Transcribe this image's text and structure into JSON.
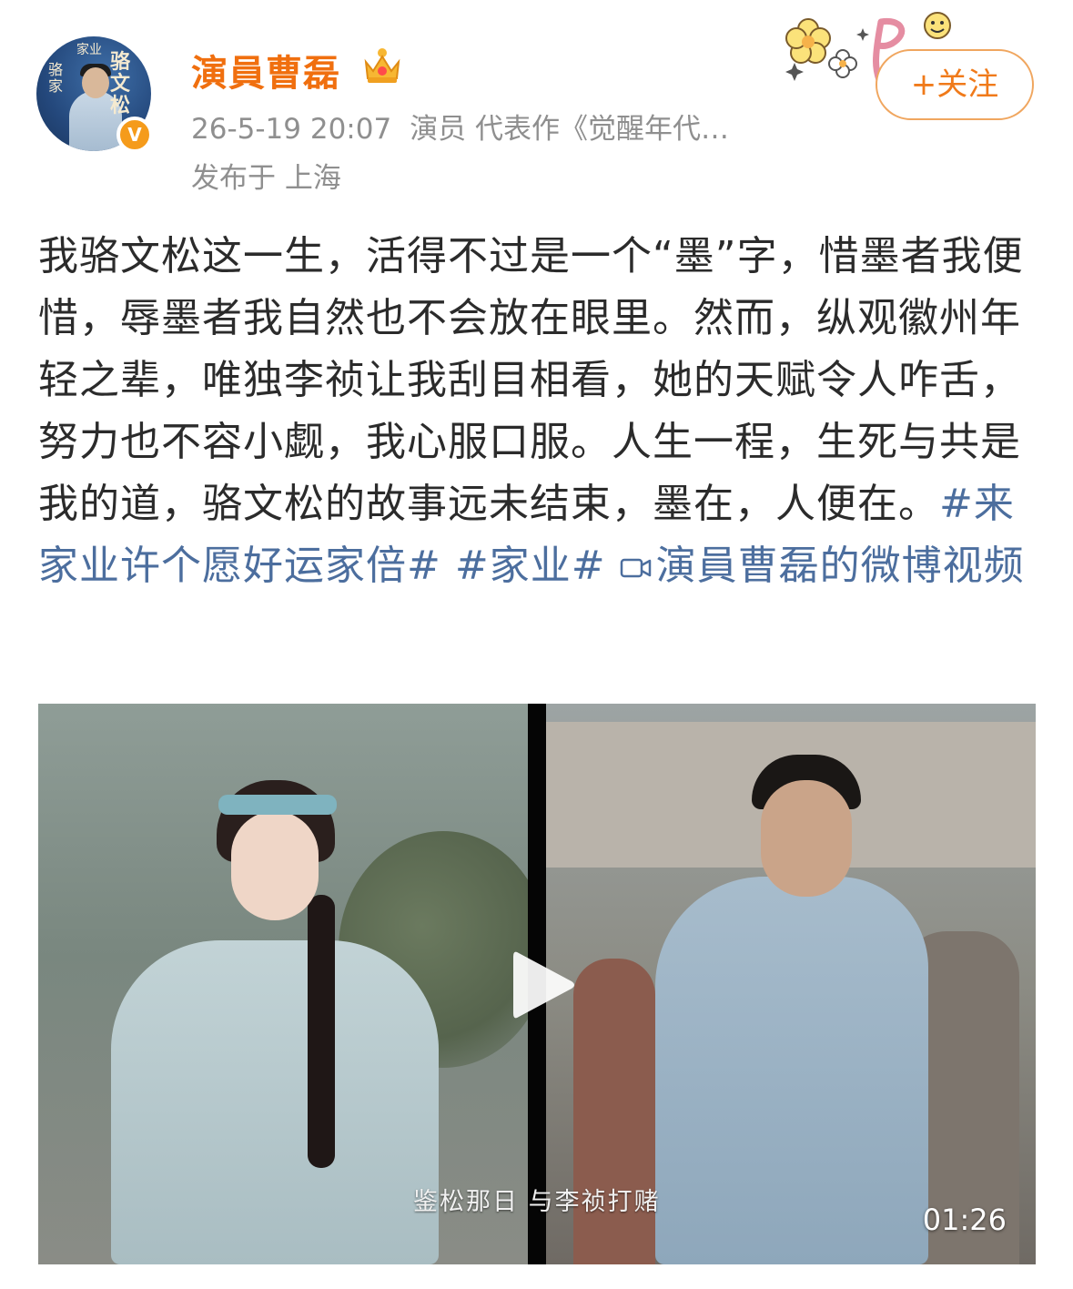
{
  "post": {
    "author": {
      "name": "演員曹磊",
      "avatar_text": {
        "title": "骆文松",
        "side": "骆家",
        "top": "家业"
      },
      "verified_mark": "V"
    },
    "meta": {
      "datetime": "26-5-19 20:07",
      "description": "演员 代表作《觉醒年代…",
      "location": "发布于 上海"
    },
    "follow_button": {
      "label": "+关注"
    },
    "content": {
      "text": "我骆文松这一生，活得不过是一个“墨”字，惜墨者我便惜，辱墨者我自然也不会放在眼里。然而，纵观徽州年轻之辈，唯独李祯让我刮目相看，她的天赋令人咋舌，努力也不容小觑，我心服口服。人生一程，生死与共是我的道，骆文松的故事远未结束，墨在，人便在。",
      "hashtags": [
        "#来家业许个愿好运家倍#",
        "#家业#"
      ],
      "video_link_label": "演員曹磊的微博视频"
    },
    "video": {
      "subtitle": "鉴松那日 与李祯打赌",
      "duration": "01:26"
    }
  },
  "icons": {
    "crown": "crown-icon",
    "sticker": "flower-sticker-icon",
    "video_link": "video-camera-icon",
    "play": "play-icon"
  },
  "colors": {
    "name": "#f06f0f",
    "link": "#4c6e9e",
    "meta": "#8f8f8f",
    "follow_border": "#f0a65f",
    "verified": "#f59b1b"
  }
}
